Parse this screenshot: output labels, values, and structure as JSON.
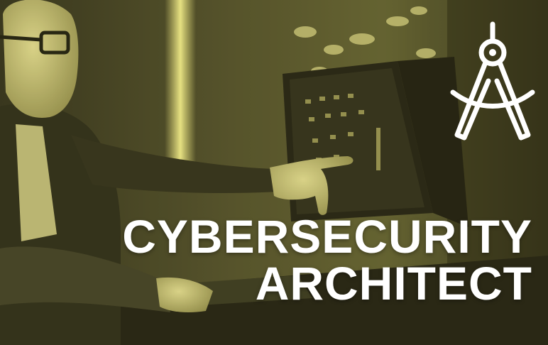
{
  "banner": {
    "title_line1": "CYBERSECURITY",
    "title_line2": "ARCHITECT",
    "icon": "drafting-compass-icon",
    "colors": {
      "tint": "#e6e07a",
      "dark": "#1f1e12",
      "text": "#ffffff"
    }
  }
}
